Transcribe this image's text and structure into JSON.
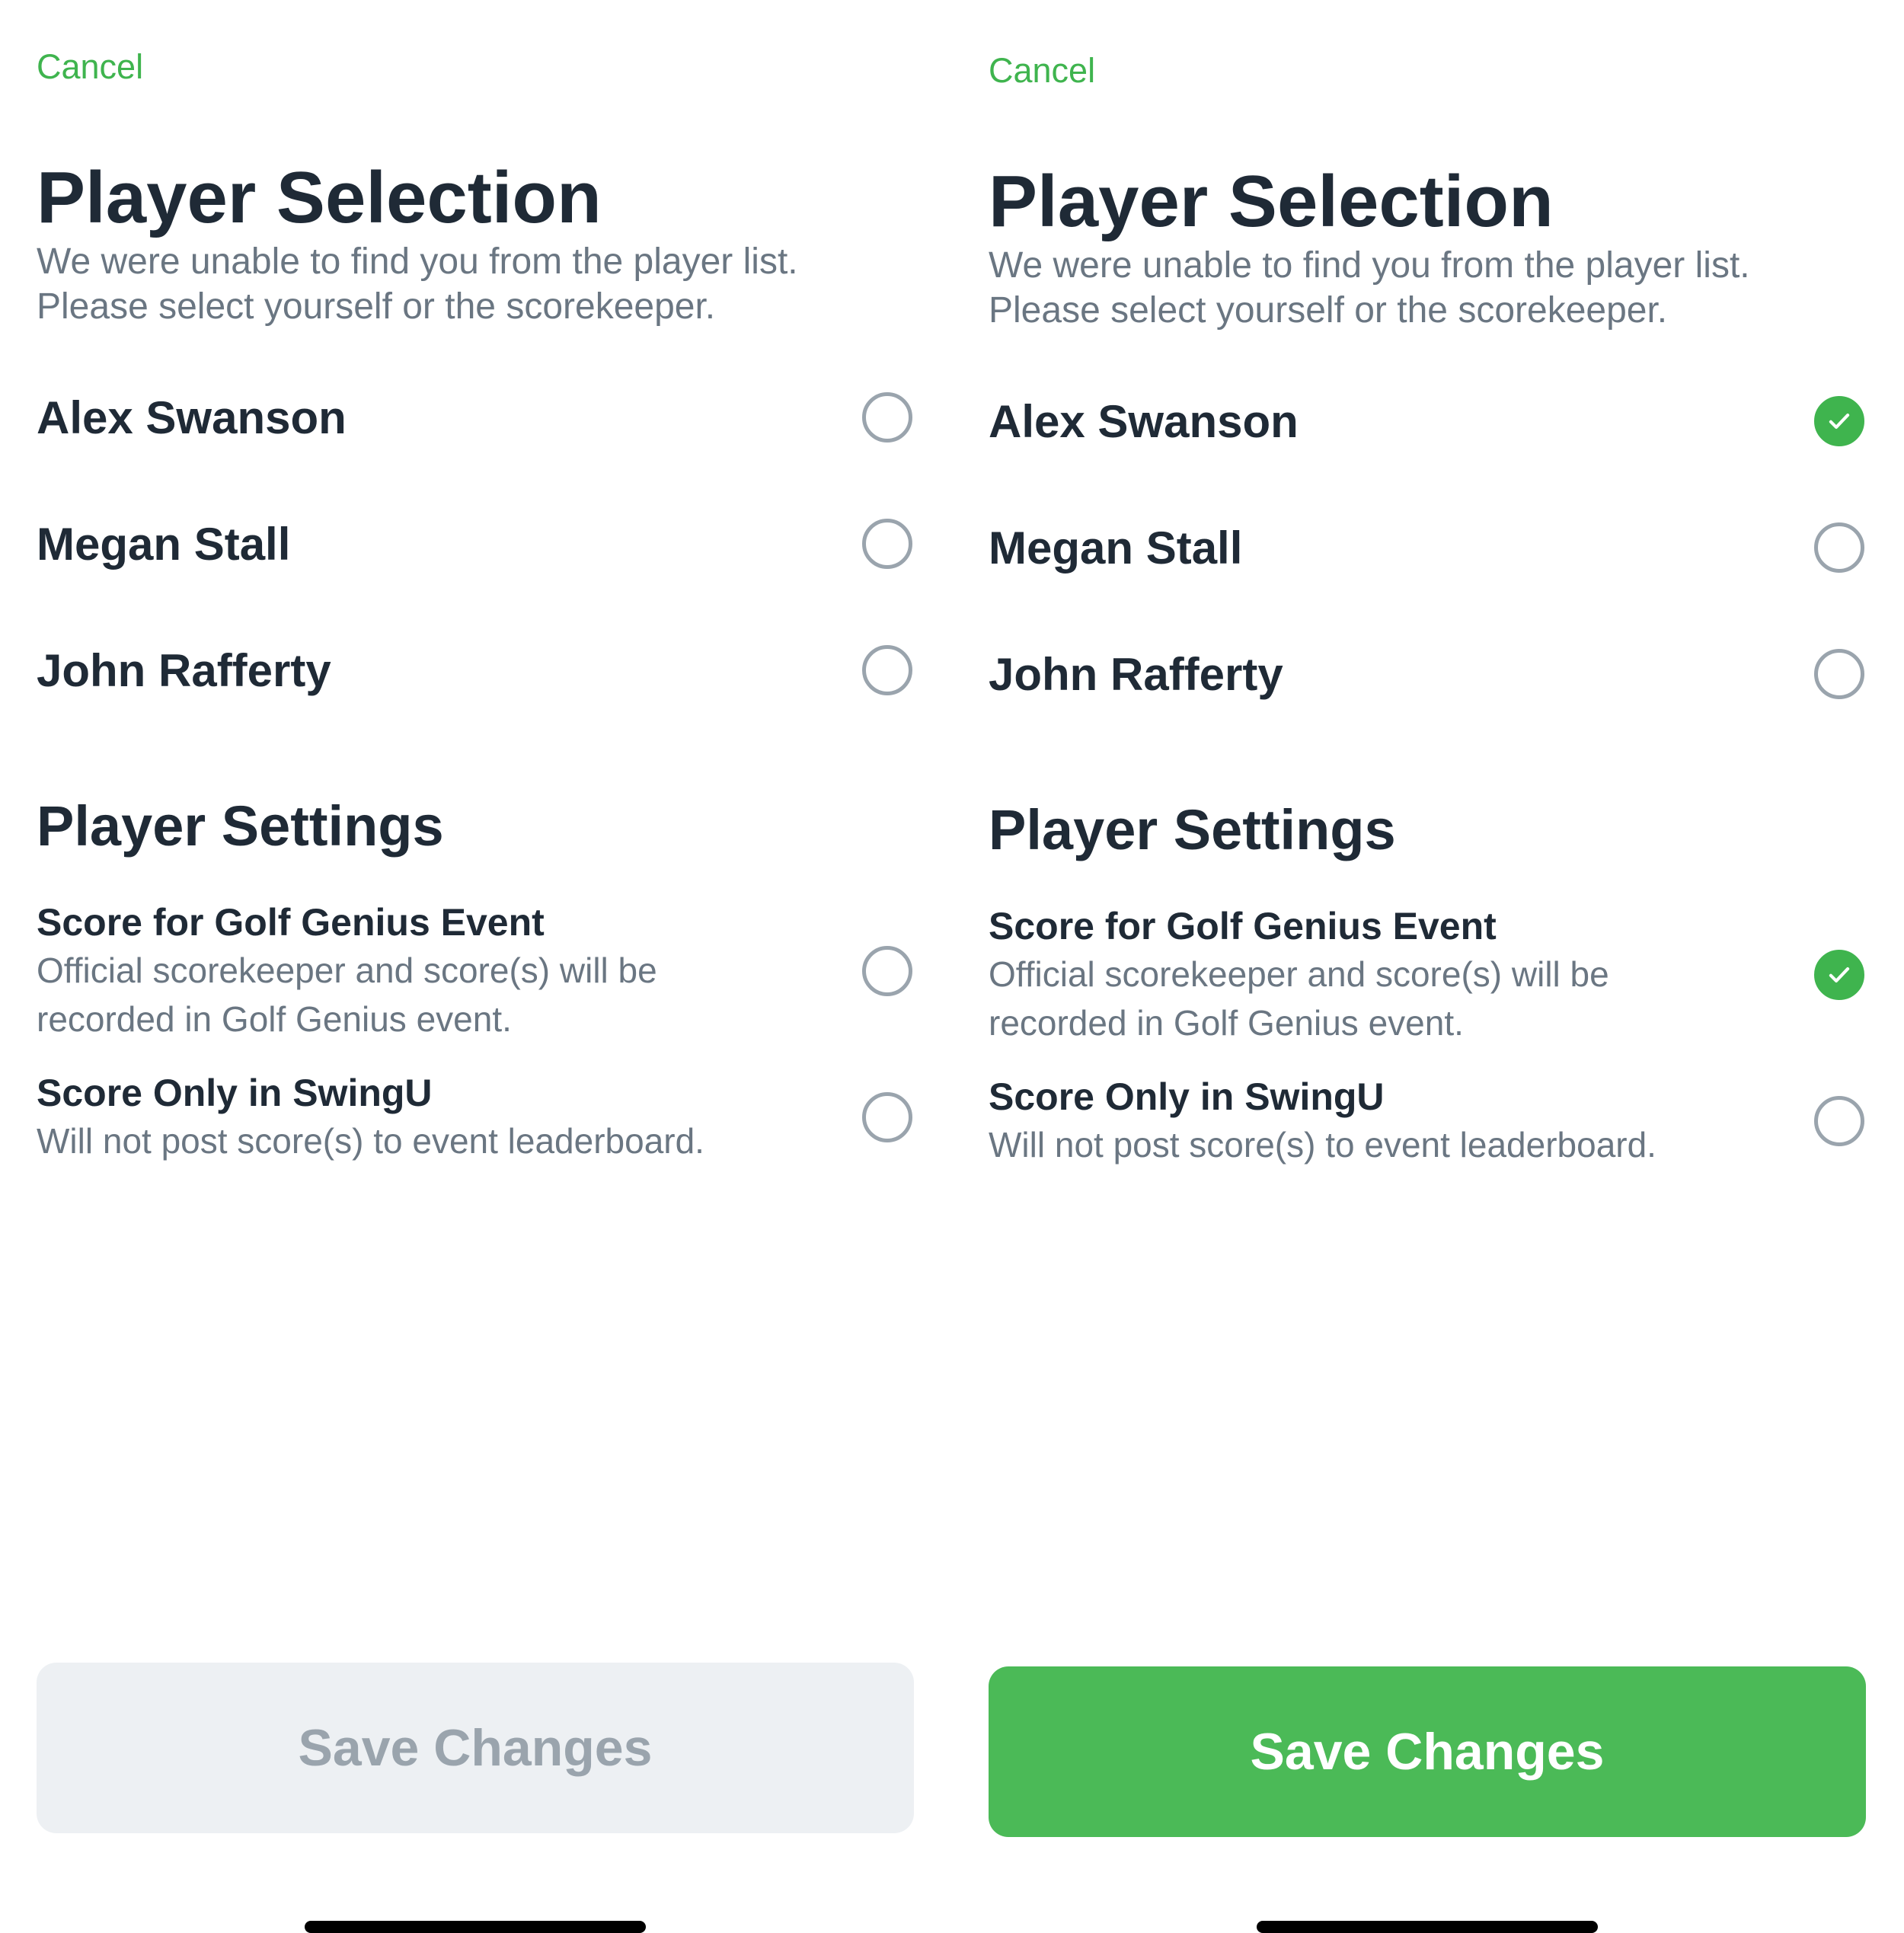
{
  "colors": {
    "accent": "#3fb44e",
    "title_text": "#1f2a36",
    "muted_text": "#6a7682",
    "radio_border": "#9aa4ad",
    "save_disabled_bg": "#edf0f3",
    "save_disabled_text": "#9aa4ad",
    "save_enabled_bg": "#4bba57",
    "save_enabled_text": "#ffffff"
  },
  "left": {
    "cancel_label": "Cancel",
    "title": "Player Selection",
    "subtitle_line1": "We were unable to find you from the player list.",
    "subtitle_line2": "Please select yourself or the scorekeeper.",
    "players": [
      {
        "name": "Alex Swanson",
        "selected": false
      },
      {
        "name": "Megan Stall",
        "selected": false
      },
      {
        "name": "John Rafferty",
        "selected": false
      }
    ],
    "settings_title": "Player Settings",
    "settings": [
      {
        "title": "Score for Golf Genius Event",
        "desc_line1": "Official scorekeeper and score(s) will be",
        "desc_line2": "recorded in Golf Genius event.",
        "selected": false
      },
      {
        "title": "Score Only in SwingU",
        "desc_line1": "Will not post score(s) to event leaderboard.",
        "selected": false
      }
    ],
    "save_label": "Save Changes",
    "save_enabled": false
  },
  "right": {
    "cancel_label": "Cancel",
    "title": "Player Selection",
    "subtitle_line1": "We were unable to find you from the player list.",
    "subtitle_line2": "Please select yourself or the scorekeeper.",
    "players": [
      {
        "name": "Alex Swanson",
        "selected": true
      },
      {
        "name": "Megan Stall",
        "selected": false
      },
      {
        "name": "John Rafferty",
        "selected": false
      }
    ],
    "settings_title": "Player Settings",
    "settings": [
      {
        "title": "Score for Golf Genius Event",
        "desc_line1": "Official scorekeeper and score(s) will be",
        "desc_line2": "recorded in Golf Genius event.",
        "selected": true
      },
      {
        "title": "Score Only in SwingU",
        "desc_line1": "Will not post score(s) to event leaderboard.",
        "selected": false
      }
    ],
    "save_label": "Save Changes",
    "save_enabled": true
  }
}
